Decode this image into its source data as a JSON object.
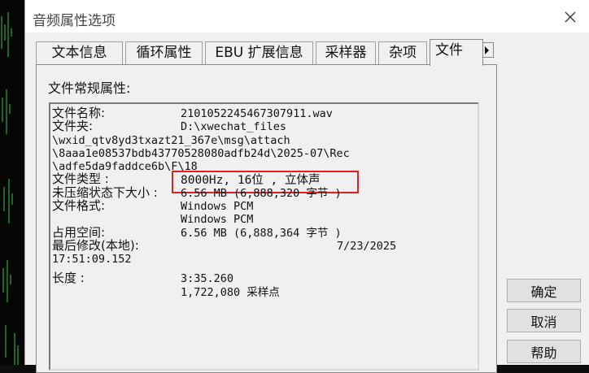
{
  "dialog": {
    "title": "音频属性选项"
  },
  "tabs": [
    {
      "label": "文本信息"
    },
    {
      "label": "循环属性"
    },
    {
      "label": "EBU 扩展信息"
    },
    {
      "label": "采样器"
    },
    {
      "label": "杂项"
    },
    {
      "label": "文件"
    }
  ],
  "group_title": "文件常规属性:",
  "info": {
    "filename_label": "文件名称:",
    "filename_value": "2101052245467307911.wav",
    "folder_label": "文件夹:",
    "folder_value": "D:\\xwechat_files",
    "path_line1": "\\wxid_qtv8yd3txazt21_367e\\msg\\attach",
    "path_line2": "\\8aaa1e08537bdb43770528080adfb24d\\2025-07\\Rec",
    "path_line3": "\\adfe5da9faddce6b\\F\\18",
    "type_label": "文件类型 :",
    "type_value": "8000Hz, 16位 , 立体声",
    "uncompressed_label": "未压缩状态下大小 :",
    "uncompressed_value": "6.56 MB (6,888,320 字节 )",
    "format_label": "文件格式:",
    "format_value1": "Windows PCM",
    "format_value2": "Windows PCM",
    "space_label": "占用空间:",
    "space_value": "6.56 MB (6,888,364 字节 )",
    "modified_label": "最后修改(本地):",
    "modified_date": "7/23/2025",
    "modified_time": "17:51:09.152",
    "length_label": "长度 :",
    "length_value": "3:35.260",
    "samples_value": "1,722,080 采样点"
  },
  "buttons": {
    "ok": "确定",
    "cancel": "取消",
    "help": "帮助"
  },
  "colors": {
    "highlight": "#e02020",
    "waveform": "#2ecc40"
  }
}
